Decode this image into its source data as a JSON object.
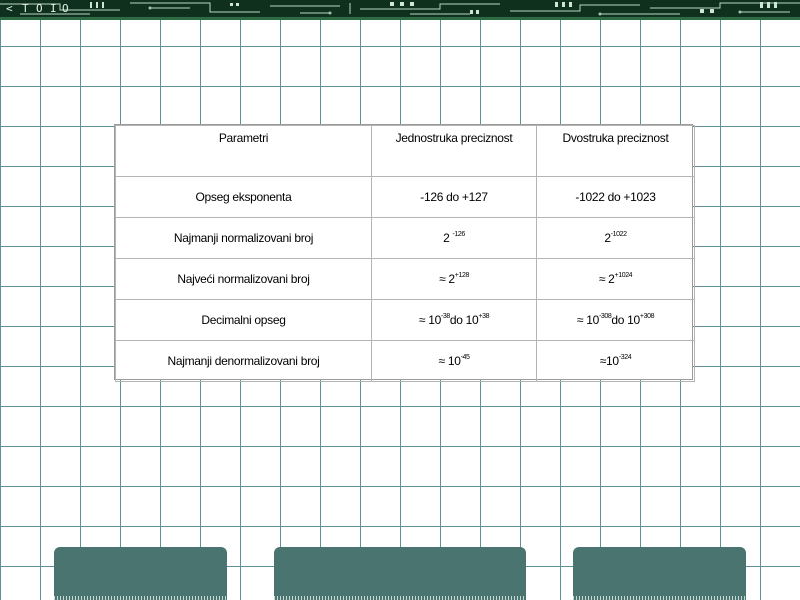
{
  "table": {
    "headers": [
      "Parametri",
      "Jednostruka preciznost",
      "Dvostruka preciznost"
    ],
    "rows": [
      {
        "label": "Opseg eksponenta",
        "single": {
          "base": "-126 do +127"
        },
        "double": {
          "base": "-1022 do +1023"
        }
      },
      {
        "label": "Najmanji normalizovani broj",
        "single": {
          "base": "2 ",
          "exp": "-126"
        },
        "double": {
          "base": "2",
          "exp": "-1022"
        }
      },
      {
        "label": "Najveći normalizovani broj",
        "single": {
          "base": "≈ 2",
          "exp": "+128"
        },
        "double": {
          "base": "≈ 2",
          "exp": "+1024"
        }
      },
      {
        "label": "Decimalni opseg",
        "single": {
          "base": "≈ 10",
          "exp": "-38",
          "mid": "do 10",
          "exp2": "+38"
        },
        "double": {
          "base": "≈ 10",
          "exp": "-308",
          "mid": "do 10",
          "exp2": "+308"
        }
      },
      {
        "label": "Najmanji denormalizovani broj",
        "single": {
          "base": "≈ 10",
          "exp": "-45"
        },
        "double": {
          "base": "≈10",
          "exp": "-324"
        }
      }
    ]
  },
  "colors": {
    "grid": "#5f8f99",
    "strip": "#10301e",
    "button": "#4a7470"
  },
  "icons": [
    "circuit-board-pattern"
  ]
}
